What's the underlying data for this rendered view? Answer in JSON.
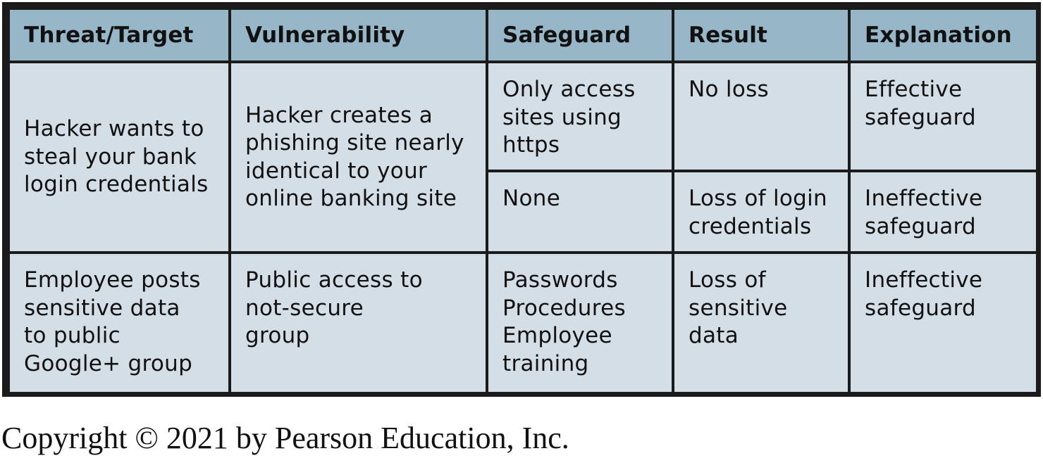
{
  "table": {
    "headers": [
      "Threat/Target",
      "Vulnerability",
      "Safeguard",
      "Result",
      "Explanation"
    ],
    "rows": {
      "phishing": {
        "threat": "Hacker wants to\nsteal your bank\nlogin credentials",
        "vulnerability": "Hacker creates a\nphishing site nearly\nidentical to your\nonline banking site",
        "outcomes": [
          {
            "safeguard": "Only access\nsites using\nhttps",
            "result": "No loss",
            "explanation": "Effective\nsafeguard"
          },
          {
            "safeguard": "None",
            "result": "Loss of login\ncredentials",
            "explanation": "Ineffective\nsafeguard"
          }
        ]
      },
      "employee": {
        "threat": "Employee posts\nsensitive data\nto public\nGoogle+ group",
        "vulnerability": "Public access to\nnot-secure\ngroup",
        "safeguard": "Passwords\nProcedures\nEmployee\ntraining",
        "result": "Loss of\nsensitive\ndata",
        "explanation": "Ineffective\nsafeguard"
      }
    }
  },
  "footer": {
    "copyright": "Copyright © 2021 by Pearson Education, Inc."
  },
  "colors": {
    "header_bg": "#97b6c7",
    "cell_bg": "#d3dee6",
    "border": "#1b1b1b"
  }
}
